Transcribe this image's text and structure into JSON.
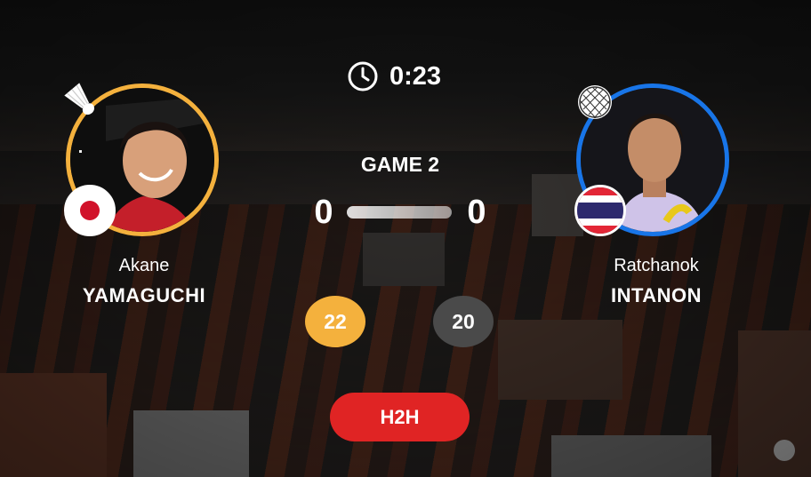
{
  "timer": {
    "icon": "clock-icon",
    "text": "0:23"
  },
  "game": {
    "label": "GAME 2",
    "score_left": "0",
    "score_right": "0"
  },
  "player1": {
    "first_name": "Akane",
    "last_name": "YAMAGUCHI",
    "points": "22",
    "ring_color": "#f4b13d",
    "flag": "japan-flag-icon",
    "sport_icon": "shuttlecock-icon"
  },
  "player2": {
    "first_name": "Ratchanok",
    "last_name": "INTANON",
    "points": "20",
    "ring_color": "#1875e8",
    "flag": "thailand-flag-icon",
    "sport_icon": "racket-icon"
  },
  "h2h_button": {
    "label": "H2H",
    "color": "#e02424"
  }
}
